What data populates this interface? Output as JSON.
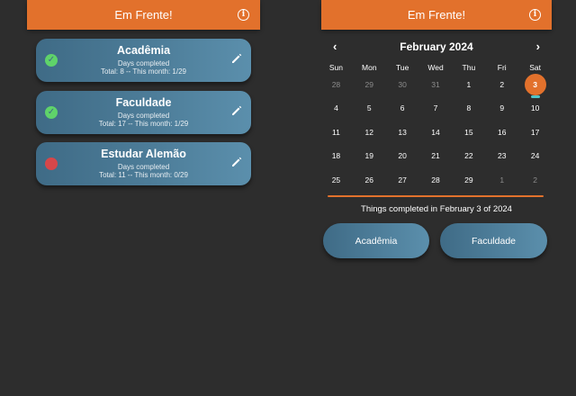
{
  "left": {
    "title": "Em Frente!",
    "info_icon": "info-icon",
    "habits": [
      {
        "name": "Acadêmia",
        "status": "completed",
        "line1": "Days completed",
        "line2": "Total: 8 -- This month: 1/29"
      },
      {
        "name": "Faculdade",
        "status": "completed",
        "line1": "Days completed",
        "line2": "Total: 17 -- This month: 1/29"
      },
      {
        "name": "Estudar Alemão",
        "status": "not-completed",
        "line1": "Days completed",
        "line2": "Total: 11 -- This month: 0/29"
      }
    ]
  },
  "right": {
    "title": "Em Frente!",
    "calendar": {
      "month": "February 2024",
      "prev": "‹",
      "next": "›",
      "weekdays": [
        "Sun",
        "Mon",
        "Tue",
        "Wed",
        "Thu",
        "Fri",
        "Sat"
      ],
      "weeks": [
        [
          "28",
          "29",
          "30",
          "31",
          "1",
          "2",
          "3"
        ],
        [
          "4",
          "5",
          "6",
          "7",
          "8",
          "9",
          "10"
        ],
        [
          "11",
          "12",
          "13",
          "14",
          "15",
          "16",
          "17"
        ],
        [
          "18",
          "19",
          "20",
          "21",
          "22",
          "23",
          "24"
        ],
        [
          "25",
          "26",
          "27",
          "28",
          "29",
          "1",
          "2"
        ]
      ],
      "selected": "3"
    },
    "things_completed": "Things completed in February 3 of 2024",
    "completed_items": [
      "Acadêmia",
      "Faculdade"
    ]
  },
  "colors": {
    "background": "#2d2d2d",
    "accent": "#e2712c",
    "card": "#4d7d99",
    "success": "#5fd36a",
    "error": "#d6474a",
    "event_marker": "#4fc3c7"
  }
}
